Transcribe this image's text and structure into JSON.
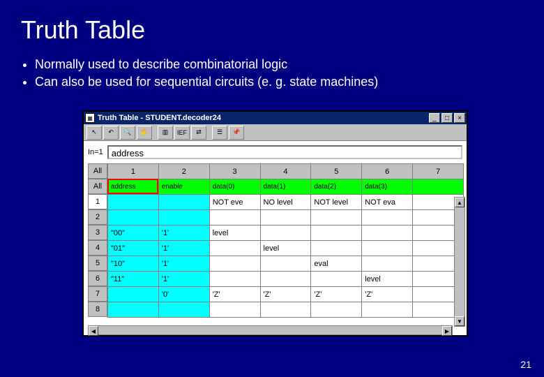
{
  "slide": {
    "title": "Truth Table",
    "bullets": [
      "Normally used to describe combinatorial logic",
      "Can also be used for sequential circuits (e. g. state machines)"
    ],
    "page_number": "21"
  },
  "window": {
    "title": "Truth Table - STUDENT.decoder24",
    "toolbar_icons": [
      "cursor",
      "undo",
      "zoom",
      "hand",
      "sheet",
      "IEF",
      "nav",
      "toggle",
      "pin"
    ]
  },
  "input": {
    "label": "In=1",
    "value": "address"
  },
  "side_labels": {
    "top": [
      "All",
      "All"
    ],
    "rows": [
      "1",
      "2",
      "3",
      "4",
      "5",
      "6",
      "7",
      "8"
    ]
  },
  "col_headers": [
    "1",
    "2",
    "3",
    "4",
    "5",
    "6",
    "7"
  ],
  "green_row": [
    "address",
    "enable",
    "data(0)",
    "data(1)",
    "data(2)",
    "data(3)",
    ""
  ],
  "data_rows": [
    [
      "",
      "",
      "NOT eve",
      "NO  level",
      "NOT level",
      "NOT eva",
      ""
    ],
    [
      "",
      "",
      "",
      "",
      "",
      "",
      ""
    ],
    [
      "\"00\"",
      "'1'",
      "level",
      "",
      "",
      "",
      ""
    ],
    [
      "\"01\"",
      "'1'",
      "",
      "level",
      "",
      "",
      ""
    ],
    [
      "\"10\"",
      "'1'",
      "",
      "",
      "eval",
      "",
      ""
    ],
    [
      "\"11\"",
      "'1'",
      "",
      "",
      "",
      "level",
      ""
    ],
    [
      "",
      "'0'",
      "'Z'",
      "'Z'",
      "'Z'",
      "'Z'",
      ""
    ],
    [
      "",
      "",
      "",
      "",
      "",
      "",
      ""
    ]
  ],
  "cyan_cols": 2,
  "winbtns": {
    "min": "_",
    "max": "□",
    "close": "×"
  },
  "icon_glyphs": {
    "cursor": "↖",
    "undo": "↶",
    "zoom": "🔍",
    "hand": "✋",
    "sheet": "▥",
    "IEF": "IEF",
    "nav": "⇄",
    "toggle": "☰",
    "pin": "📌"
  }
}
